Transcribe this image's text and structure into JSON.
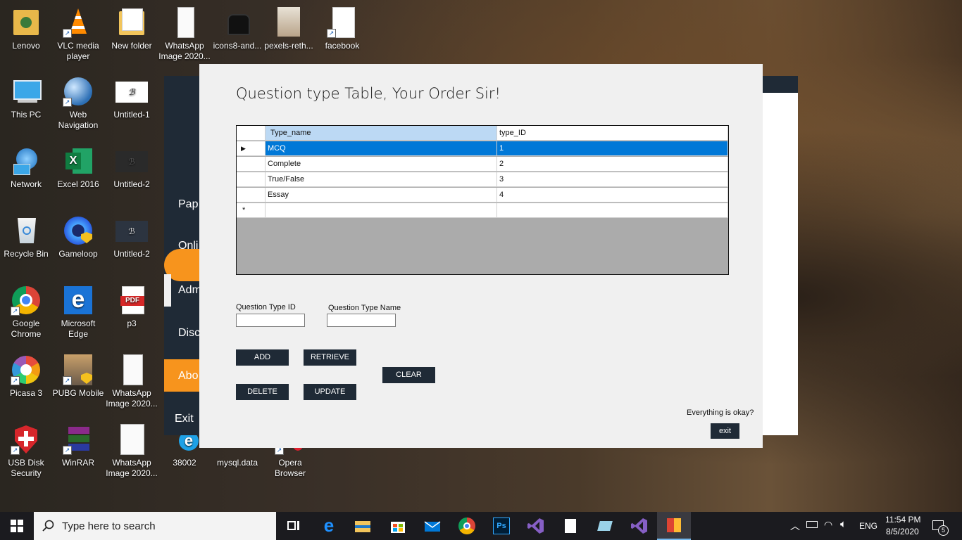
{
  "desktop": {
    "icons": [
      {
        "label": "Lenovo"
      },
      {
        "label": "VLC media player"
      },
      {
        "label": "New folder"
      },
      {
        "label": "WhatsApp Image 2020..."
      },
      {
        "label": "icons8-and..."
      },
      {
        "label": "pexels-reth..."
      },
      {
        "label": "facebook"
      },
      {
        "label": "This PC"
      },
      {
        "label": "Web Navigation"
      },
      {
        "label": "Untitled-1"
      },
      {
        "label": "Network"
      },
      {
        "label": "Excel 2016"
      },
      {
        "label": "Untitled-2"
      },
      {
        "label": "Recycle Bin"
      },
      {
        "label": "Gameloop"
      },
      {
        "label": "Untitled-2"
      },
      {
        "label": "Google Chrome"
      },
      {
        "label": "Microsoft Edge"
      },
      {
        "label": "p3"
      },
      {
        "label": "Picasa 3"
      },
      {
        "label": "PUBG Mobile"
      },
      {
        "label": "WhatsApp Image 2020..."
      },
      {
        "label": "USB Disk Security"
      },
      {
        "label": "WinRAR"
      },
      {
        "label": "WhatsApp Image 2020..."
      },
      {
        "label": "38002"
      },
      {
        "label": "mysql.data"
      },
      {
        "label": "Opera Browser"
      }
    ]
  },
  "back_app": {
    "menu": [
      "Pap",
      "Onli",
      "Adm",
      "Disc",
      "Abo",
      "Exit"
    ]
  },
  "dialog": {
    "title": "Question type Table, Your Order Sir!",
    "grid": {
      "columns": [
        "Type_name",
        "type_ID"
      ],
      "rows": [
        {
          "name": "MCQ",
          "id": "1"
        },
        {
          "name": "Complete",
          "id": "2"
        },
        {
          "name": "True/False",
          "id": "3"
        },
        {
          "name": "Essay",
          "id": "4"
        }
      ],
      "current_row_marker": "▶",
      "new_row_marker": "*"
    },
    "fields": {
      "type_id_label": "Question Type ID",
      "type_name_label": "Question Type Name",
      "type_id_value": "",
      "type_name_value": ""
    },
    "buttons": {
      "add": "ADD",
      "retrieve": "RETRIEVE",
      "clear": "CLEAR",
      "delete": "DELETE",
      "update": "UPDATE",
      "exit": "exit"
    },
    "footer_text": "Everything is okay?"
  },
  "taskbar": {
    "search_placeholder": "Type here to search",
    "language": "ENG",
    "time": "11:54 PM",
    "date": "8/5/2020",
    "notification_count": "5"
  },
  "colors": {
    "selection": "#0078d7",
    "button_bg": "#1f2a36",
    "header_highlight": "#bcd9f4",
    "accent_orange": "#f7941d"
  }
}
